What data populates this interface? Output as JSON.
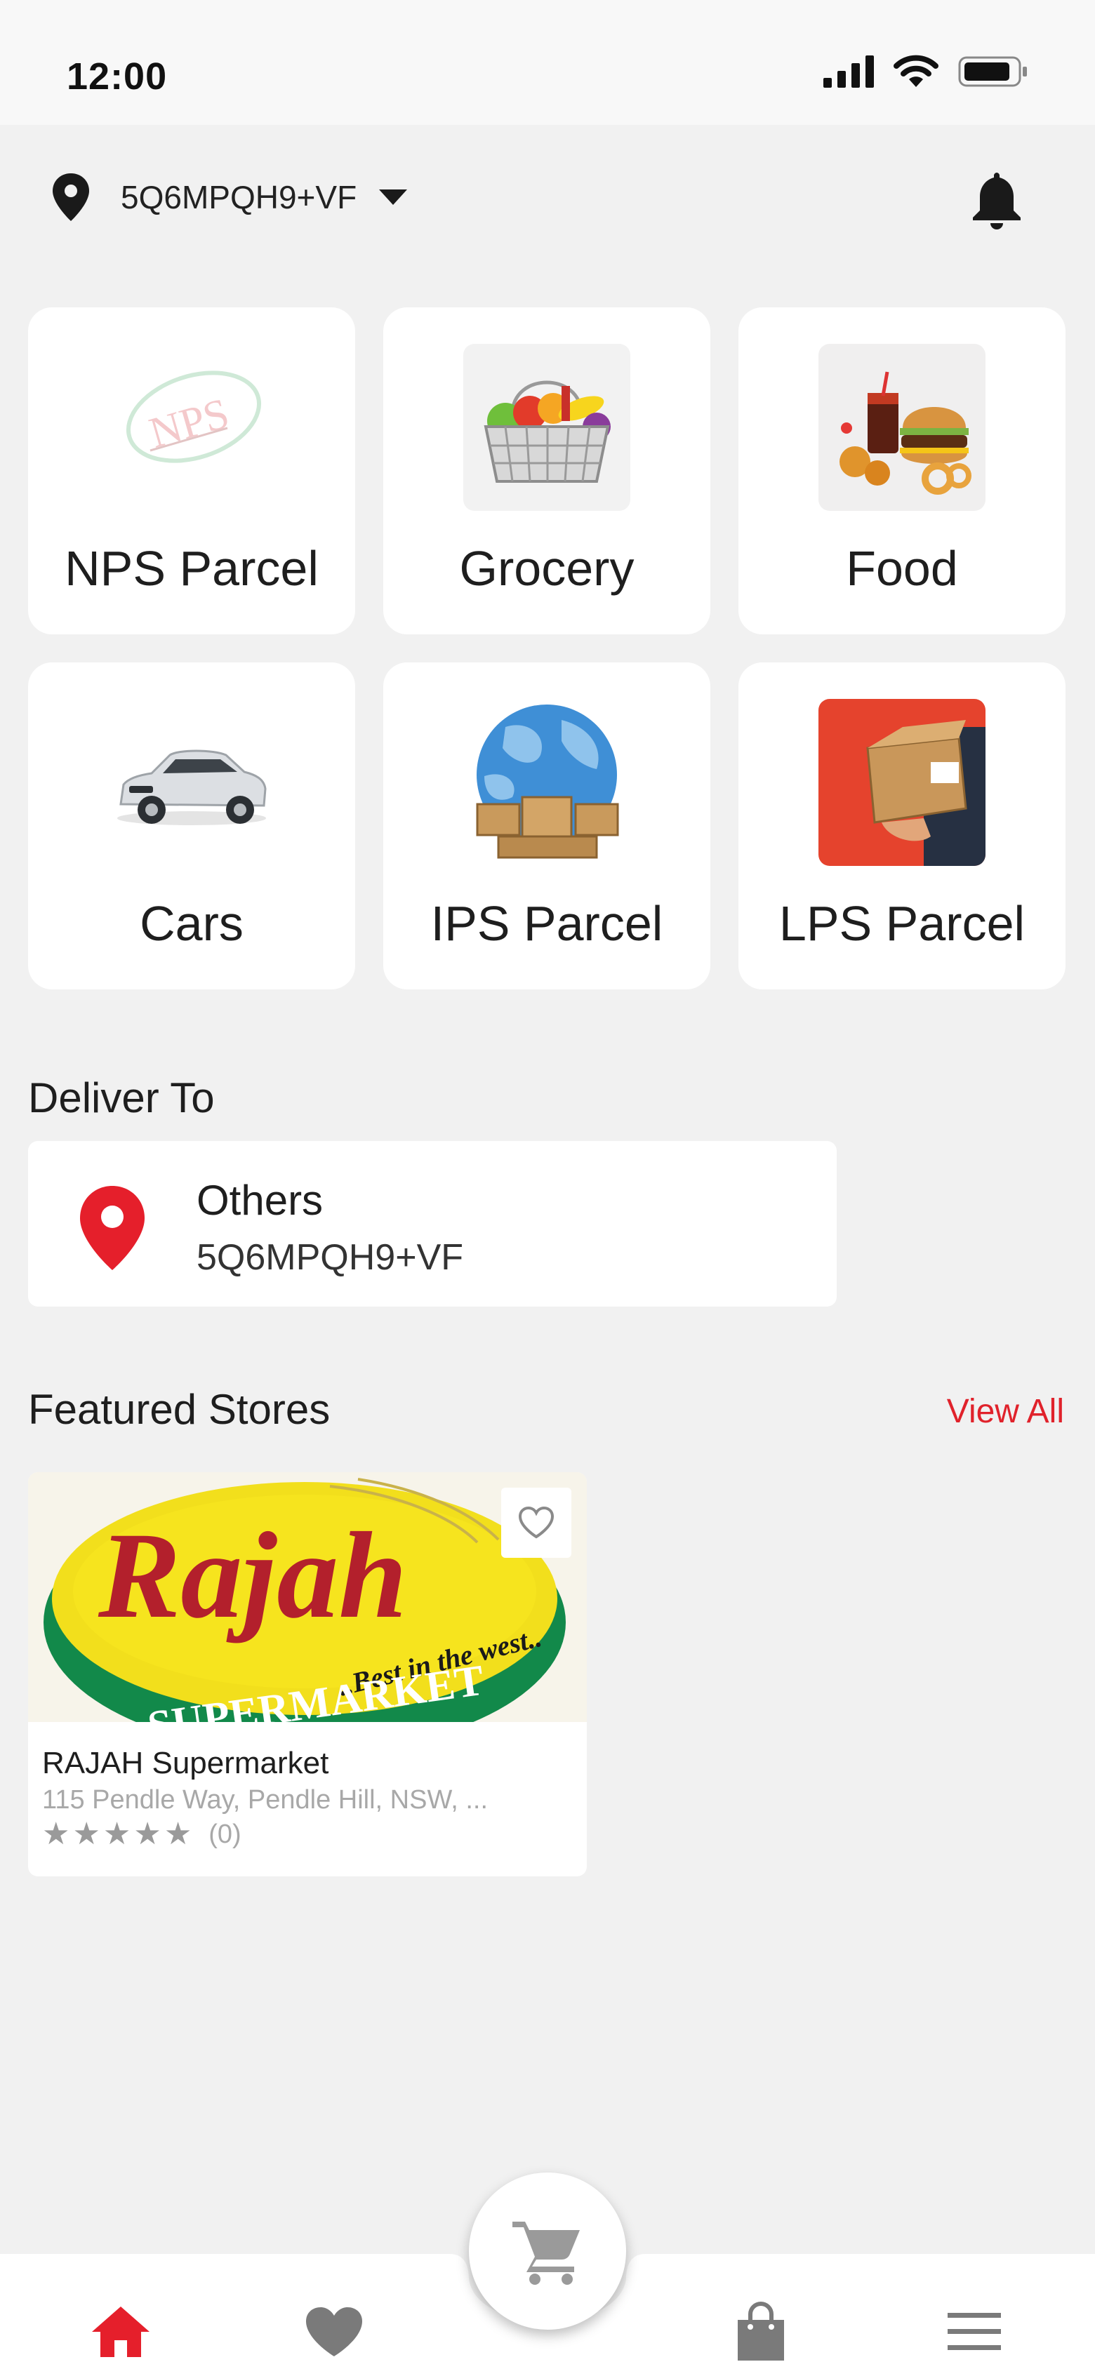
{
  "status_bar": {
    "time": "12:00"
  },
  "header": {
    "location_code": "5Q6MPQH9+VF"
  },
  "categories": [
    {
      "label": "NPS Parcel",
      "image_text": "NPS"
    },
    {
      "label": "Grocery"
    },
    {
      "label": "Food"
    },
    {
      "label": "Cars"
    },
    {
      "label": "IPS Parcel"
    },
    {
      "label": "LPS Parcel"
    }
  ],
  "deliver_to": {
    "title": "Deliver To",
    "type": "Others",
    "address": "5Q6MPQH9+VF"
  },
  "featured": {
    "title": "Featured Stores",
    "view_all": "View All",
    "stores": [
      {
        "name": "RAJAH Supermarket",
        "address": "115 Pendle Way, Pendle Hill, NSW, ...",
        "rating_count": "(0)",
        "stars": 0,
        "logo_text": "Rajah",
        "logo_tagline": "..Best in the west..",
        "logo_banner": "SUPERMARKET"
      }
    ]
  },
  "colors": {
    "accent": "#e0222b",
    "background": "#f1f1f1",
    "card": "#ffffff",
    "icon_grey": "#7a7a7a"
  },
  "icons": {
    "header": [
      "location-pin-icon",
      "caret-down-icon",
      "bell-icon"
    ],
    "nav": [
      "home-icon",
      "heart-icon",
      "cart-icon",
      "bag-icon",
      "menu-icon"
    ]
  }
}
